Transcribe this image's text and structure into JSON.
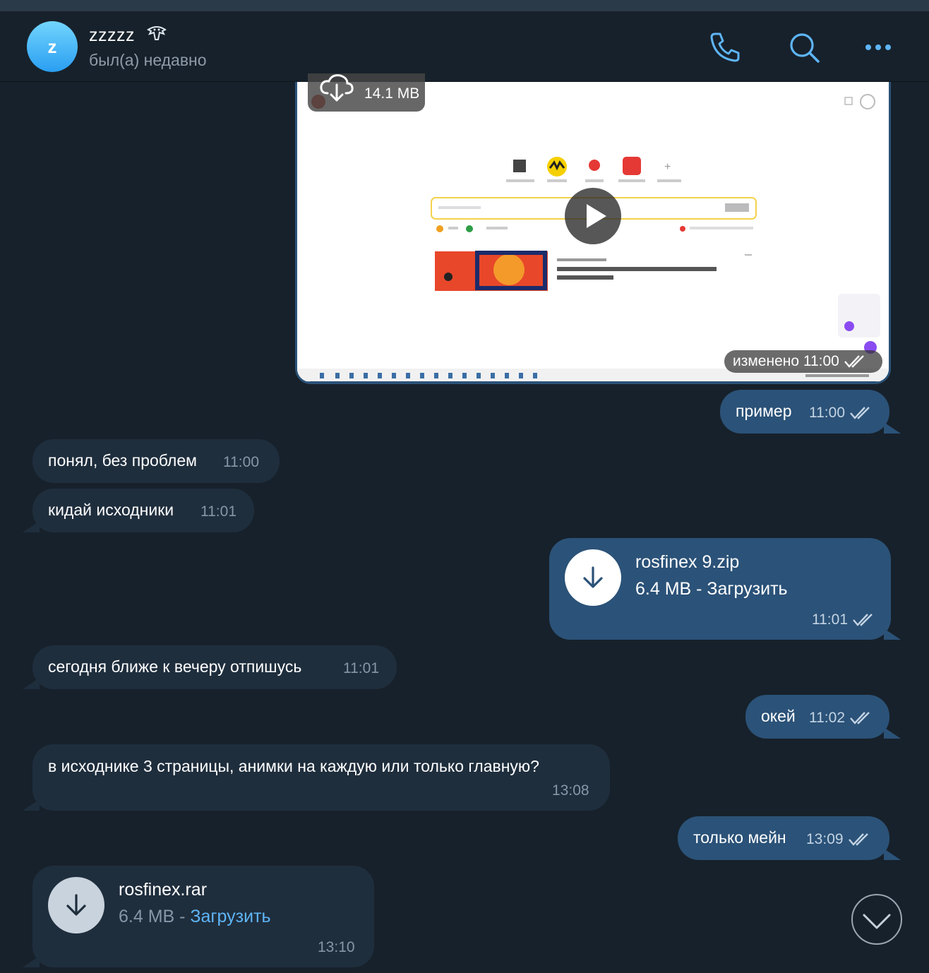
{
  "header": {
    "avatar_letter": "z",
    "name": "zzzzz",
    "name_emoji_icon": "ghost-emoji",
    "status": "был(а) недавно",
    "icons": [
      "phone-icon",
      "search-icon",
      "more-icon"
    ],
    "accent": "#5eb5f7"
  },
  "media_message": {
    "size": "14.1 MB",
    "edited_label": "изменено 11:00"
  },
  "messages": [
    {
      "dir": "out",
      "text": "пример",
      "time": "11:00"
    },
    {
      "dir": "in",
      "text": "понял, без проблем",
      "time": "11:00"
    },
    {
      "dir": "in",
      "text": "кидай исходники",
      "time": "11:01"
    },
    {
      "dir": "out",
      "type": "file",
      "name": "rosfinex 9.zip",
      "size": "6.4 MB",
      "sep": " - ",
      "action": "Загрузить",
      "time": "11:01"
    },
    {
      "dir": "in",
      "text": "сегодня ближе к вечеру отпишусь",
      "time": "11:01"
    },
    {
      "dir": "out",
      "text": "окей",
      "time": "11:02"
    },
    {
      "dir": "in",
      "text": "в исходнике 3 страницы, анимки на каждую или только главную?",
      "time": "13:08"
    },
    {
      "dir": "out",
      "text": "только мейн",
      "time": "13:09"
    },
    {
      "dir": "in",
      "type": "file",
      "name": "rosfinex.rar",
      "size": "6.4 MB",
      "sep": " - ",
      "action": "Загрузить",
      "time": "13:10"
    }
  ],
  "colors": {
    "background": "#17212b",
    "outgoing": "#2b5278",
    "incoming": "#1f2e3d",
    "link": "#5eb5f7"
  }
}
